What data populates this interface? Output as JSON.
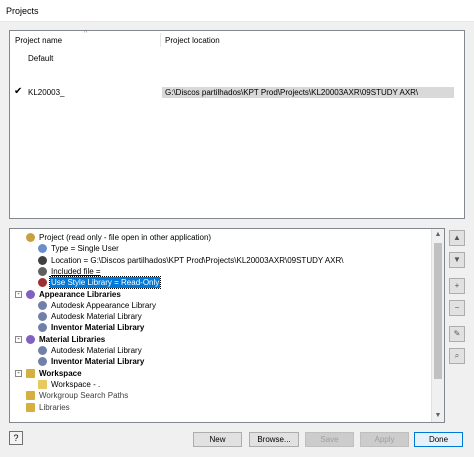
{
  "window": {
    "title": "Projects"
  },
  "project_list": {
    "columns": [
      "Project name",
      "Project location"
    ],
    "rows": [
      {
        "name": "Default",
        "location": "",
        "active": false
      },
      {
        "name": "KL20003_",
        "location": "G:\\Discos partilhados\\KPT Prod\\Projects\\KL20003AXR\\09STUDY AXR\\",
        "active": true
      }
    ]
  },
  "tree": {
    "items": [
      {
        "label": "Project (read only - file open in other application)",
        "icon": "project-icon",
        "indent": 0,
        "bold": false
      },
      {
        "label": "Type = Single User",
        "icon": "person-icon",
        "indent": 1,
        "bold": false
      },
      {
        "label": "Location = G:\\Discos partilhados\\KPT Prod\\Projects\\KL20003AXR\\09STUDY AXR\\",
        "icon": "text-field-icon",
        "indent": 1,
        "bold": false
      },
      {
        "label": "Included file =",
        "icon": "document-arrow-icon",
        "indent": 1,
        "bold": false,
        "underline": true
      },
      {
        "label": "Use Style Library = Read-Only",
        "icon": "style-library-icon",
        "indent": 1,
        "bold": false,
        "selected": true
      },
      {
        "label": "Appearance Libraries",
        "icon": "appearance-library-icon",
        "indent": 0,
        "bold": true,
        "expander": "-"
      },
      {
        "label": "Autodesk Appearance Library",
        "icon": "library-icon",
        "indent": 1,
        "bold": false
      },
      {
        "label": "Autodesk Material Library",
        "icon": "library-icon",
        "indent": 1,
        "bold": false
      },
      {
        "label": "Inventor Material Library",
        "icon": "library-icon",
        "indent": 1,
        "bold": true
      },
      {
        "label": "Material Libraries",
        "icon": "material-library-icon",
        "indent": 0,
        "bold": true,
        "expander": "-"
      },
      {
        "label": "Autodesk Material Library",
        "icon": "library-icon",
        "indent": 1,
        "bold": false
      },
      {
        "label": "Inventor Material Library",
        "icon": "library-icon",
        "indent": 1,
        "bold": true
      },
      {
        "label": "Workspace",
        "icon": "workspace-icon",
        "indent": 0,
        "bold": true,
        "expander": "-"
      },
      {
        "label": "Workspace - .",
        "icon": "folder-icon",
        "indent": 1,
        "bold": false
      },
      {
        "label": "Workgroup Search Paths",
        "icon": "workgroup-icon",
        "indent": 0,
        "bold": false,
        "gray": true
      },
      {
        "label": "Libraries",
        "icon": "libraries-icon",
        "indent": 0,
        "bold": false,
        "gray": true
      }
    ]
  },
  "side_buttons": [
    {
      "name": "move-up-button",
      "icon": "triangle-up-icon",
      "glyph": "▲"
    },
    {
      "name": "move-down-button",
      "icon": "triangle-down-icon",
      "glyph": "▼"
    },
    {
      "name": "add-button",
      "icon": "plus-icon",
      "glyph": "+"
    },
    {
      "name": "remove-button",
      "icon": "minus-icon",
      "glyph": "−"
    },
    {
      "name": "edit-button",
      "icon": "pencil-icon",
      "glyph": "✎"
    },
    {
      "name": "browse-tree-button",
      "icon": "find-icon",
      "glyph": "⌕"
    }
  ],
  "buttons": {
    "help": "?",
    "new": "New",
    "browse": "Browse...",
    "save": "Save",
    "apply": "Apply",
    "done": "Done"
  }
}
